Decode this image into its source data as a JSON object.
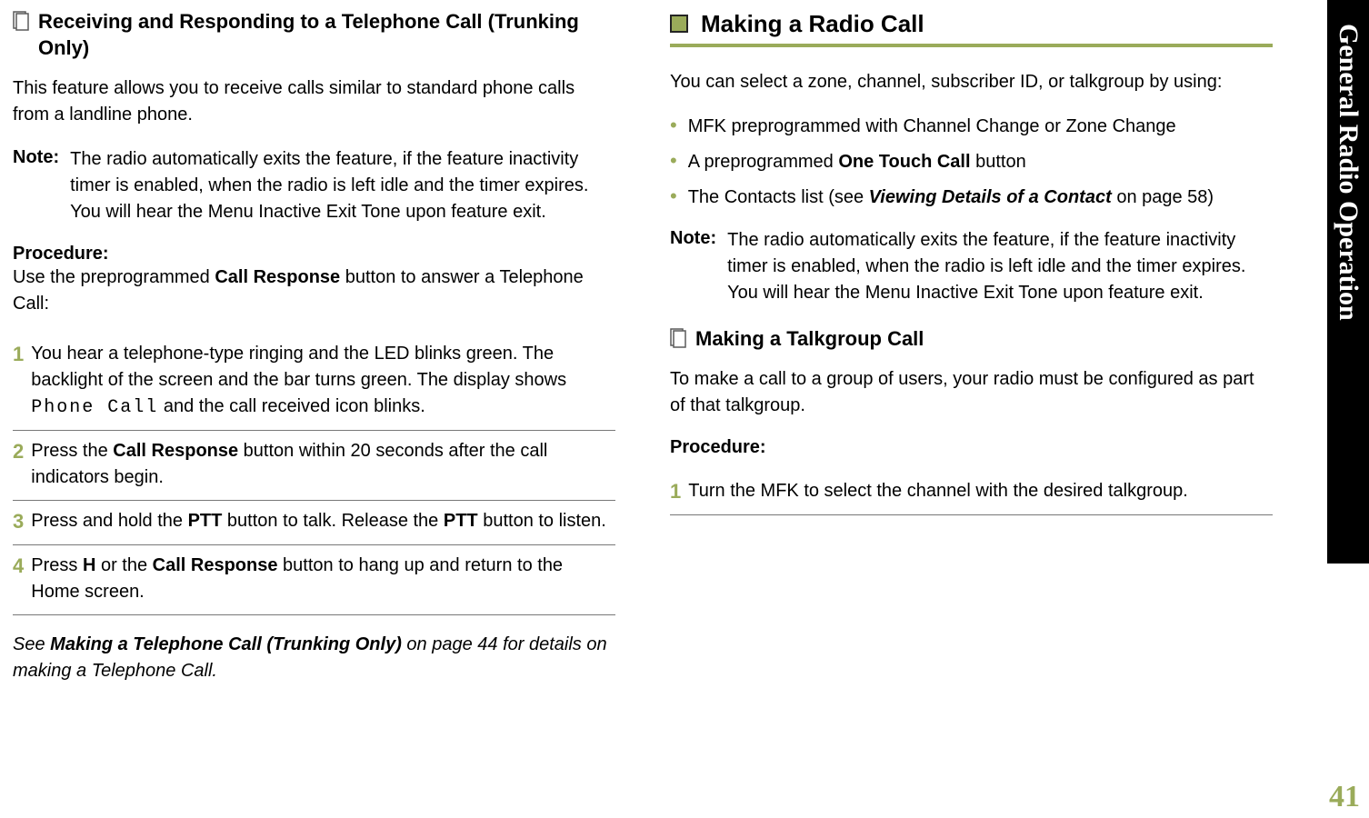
{
  "side": {
    "chapter": "General Radio Operation",
    "page": "41"
  },
  "left": {
    "heading": "Receiving and Responding to a Telephone Call (Trunking Only)",
    "intro": "This feature allows you to receive calls similar to standard phone calls from a landline phone.",
    "note_label": "Note:",
    "note_body": "The radio automatically exits the feature, if the feature inactivity timer is enabled, when the radio is left idle and the timer expires. You will hear the Menu Inactive Exit Tone upon feature exit.",
    "procedure_label": "Procedure:",
    "procedure_intro_pre": "Use the preprogrammed ",
    "procedure_intro_bold": "Call Response",
    "procedure_intro_post": " button to answer a Telephone Call:",
    "steps": [
      {
        "num": "1",
        "pre": "You hear a telephone-type ringing and the LED blinks green. The backlight of the screen and the bar turns green. The display shows ",
        "display": "Phone Call",
        "post": " and the call received icon blinks."
      },
      {
        "num": "2",
        "pre": "Press the ",
        "bold1": "Call Response",
        "mid": " button within 20 seconds after the call indicators begin.",
        "post": ""
      },
      {
        "num": "3",
        "pre": "Press and hold the ",
        "bold1": "PTT",
        "mid": " button to talk. Release the ",
        "bold2": "PTT",
        "post": " button to listen."
      },
      {
        "num": "4",
        "pre": "Press ",
        "homekey": "H",
        "mid": " or the ",
        "bold1": "Call Response",
        "post": " button to hang up and return to the Home screen."
      }
    ],
    "seealso_pre": "See ",
    "seealso_bold": "Making a Telephone Call (Trunking Only)",
    "seealso_post": " on page 44 for details on making a Telephone Call."
  },
  "right": {
    "heading": "Making a Radio Call",
    "intro": "You can select a zone, channel, subscriber ID, or talkgroup by using:",
    "bullets": [
      {
        "pre": "MFK preprogrammed with Channel Change or Zone Change"
      },
      {
        "pre": "A preprogrammed ",
        "bold": "One Touch Call",
        "post": " button"
      },
      {
        "pre": "The Contacts list (see ",
        "boldit": "Viewing Details of a Contact",
        "post": " on page 58)"
      }
    ],
    "note_label": "Note:",
    "note_body": "The radio automatically exits the feature, if the feature inactivity timer is enabled, when the radio is left idle and the timer expires. You will hear the Menu Inactive Exit Tone upon feature exit.",
    "subheading": "Making a Talkgroup Call",
    "sub_intro": "To make a call to a group of users, your radio must be configured as part of that talkgroup.",
    "procedure_label": "Procedure:",
    "steps": [
      {
        "num": "1",
        "text": "Turn the MFK to select the channel with the desired talkgroup."
      }
    ]
  }
}
